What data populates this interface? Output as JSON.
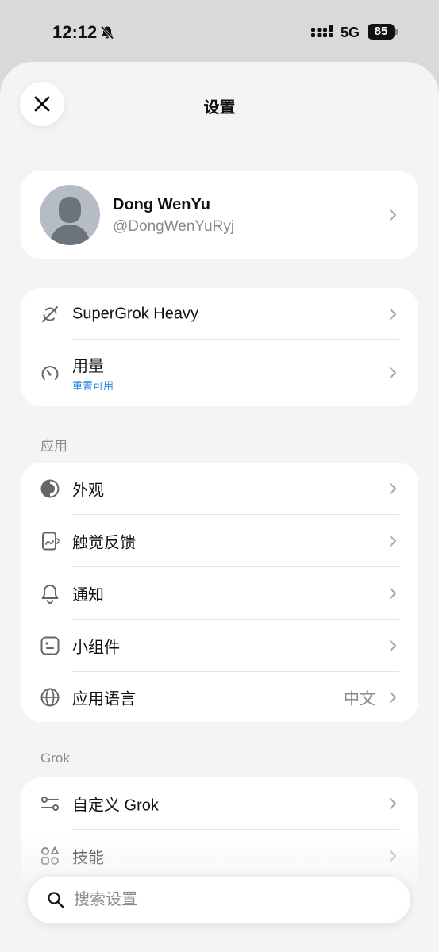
{
  "status_bar": {
    "time": "12:12",
    "network": "5G",
    "battery": "85"
  },
  "header": {
    "title": "设置"
  },
  "profile": {
    "name": "Dong WenYu",
    "handle": "@DongWenYuRyj"
  },
  "account": {
    "items": [
      {
        "label": "SuperGrok Heavy"
      },
      {
        "label": "用量",
        "sublabel": "重置可用"
      }
    ]
  },
  "app_section": {
    "title": "应用",
    "items": [
      {
        "label": "外观"
      },
      {
        "label": "触觉反馈"
      },
      {
        "label": "通知"
      },
      {
        "label": "小组件"
      },
      {
        "label": "应用语言",
        "value": "中文"
      }
    ]
  },
  "grok_section": {
    "title": "Grok",
    "items": [
      {
        "label": "自定义 Grok"
      },
      {
        "label": "技能"
      }
    ]
  },
  "search": {
    "placeholder": "搜索设置"
  },
  "colors": {
    "accent": "#2d86e8",
    "background": "#f4f4f4",
    "card": "#ffffff"
  }
}
